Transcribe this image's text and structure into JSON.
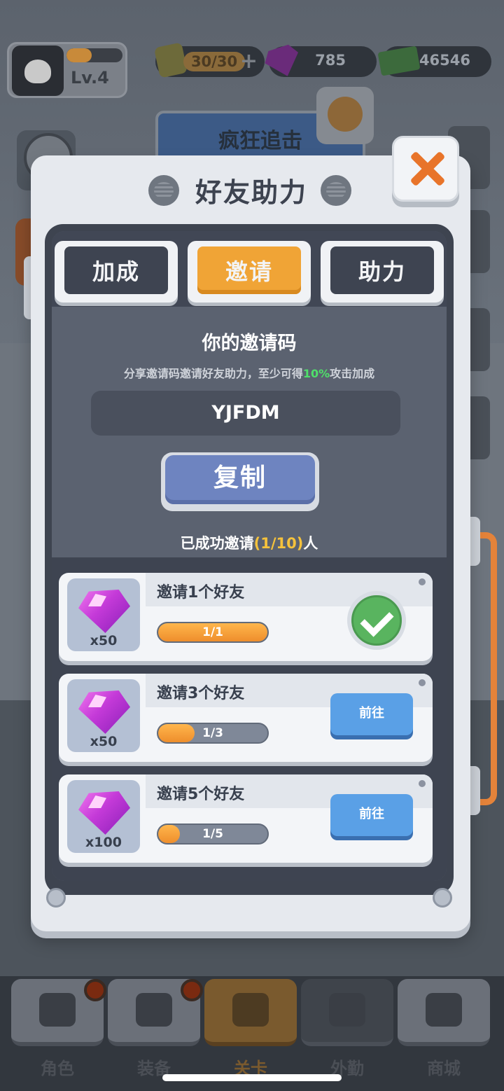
{
  "hud": {
    "level": "Lv.4",
    "xp_fraction": 0.45,
    "energy": "30/30",
    "energy_plus": "+",
    "gems": "785",
    "cash": "46546"
  },
  "background": {
    "event_title": "疯狂追击"
  },
  "bottom_nav": {
    "items": [
      {
        "label": "角色",
        "icon": "skull-icon",
        "badge": true
      },
      {
        "label": "装备",
        "icon": "gun-icon",
        "badge": true
      },
      {
        "label": "关卡",
        "icon": "map-pin-icon",
        "active": true
      },
      {
        "label": "外勤",
        "icon": "lock-icon",
        "locked": true
      },
      {
        "label": "商城",
        "icon": "shop-icon"
      }
    ]
  },
  "modal": {
    "title": "好友助力",
    "tabs": [
      {
        "label": "加成",
        "active": false
      },
      {
        "label": "邀请",
        "active": true
      },
      {
        "label": "助力",
        "active": false
      }
    ],
    "invite": {
      "heading": "你的邀请码",
      "sub_before": "分享邀请码邀请好友助力，至少可得",
      "sub_highlight": "10%",
      "sub_after": "攻击加成",
      "code": "YJFDM",
      "copy_label": "复制",
      "invited_prefix": "已成功邀请",
      "invited_count": "(1/10)",
      "invited_suffix": "人"
    },
    "rewards": [
      {
        "title": "邀请1个好友",
        "qty": "x50",
        "progress_text": "1/1",
        "progress": 1.0,
        "status": "claimed"
      },
      {
        "title": "邀请3个好友",
        "qty": "x50",
        "progress_text": "1/3",
        "progress": 0.333,
        "status": "go",
        "button": "前往"
      },
      {
        "title": "邀请5个好友",
        "qty": "x100",
        "progress_text": "1/5",
        "progress": 0.2,
        "status": "go",
        "button": "前往"
      }
    ]
  },
  "colors": {
    "accent_orange": "#f0a436",
    "highlight_green": "#4fe06a",
    "count_yellow": "#f5c23c",
    "go_blue": "#5aa0e6",
    "copy_blue": "#6e84c0",
    "close_orange": "#e8742a"
  }
}
